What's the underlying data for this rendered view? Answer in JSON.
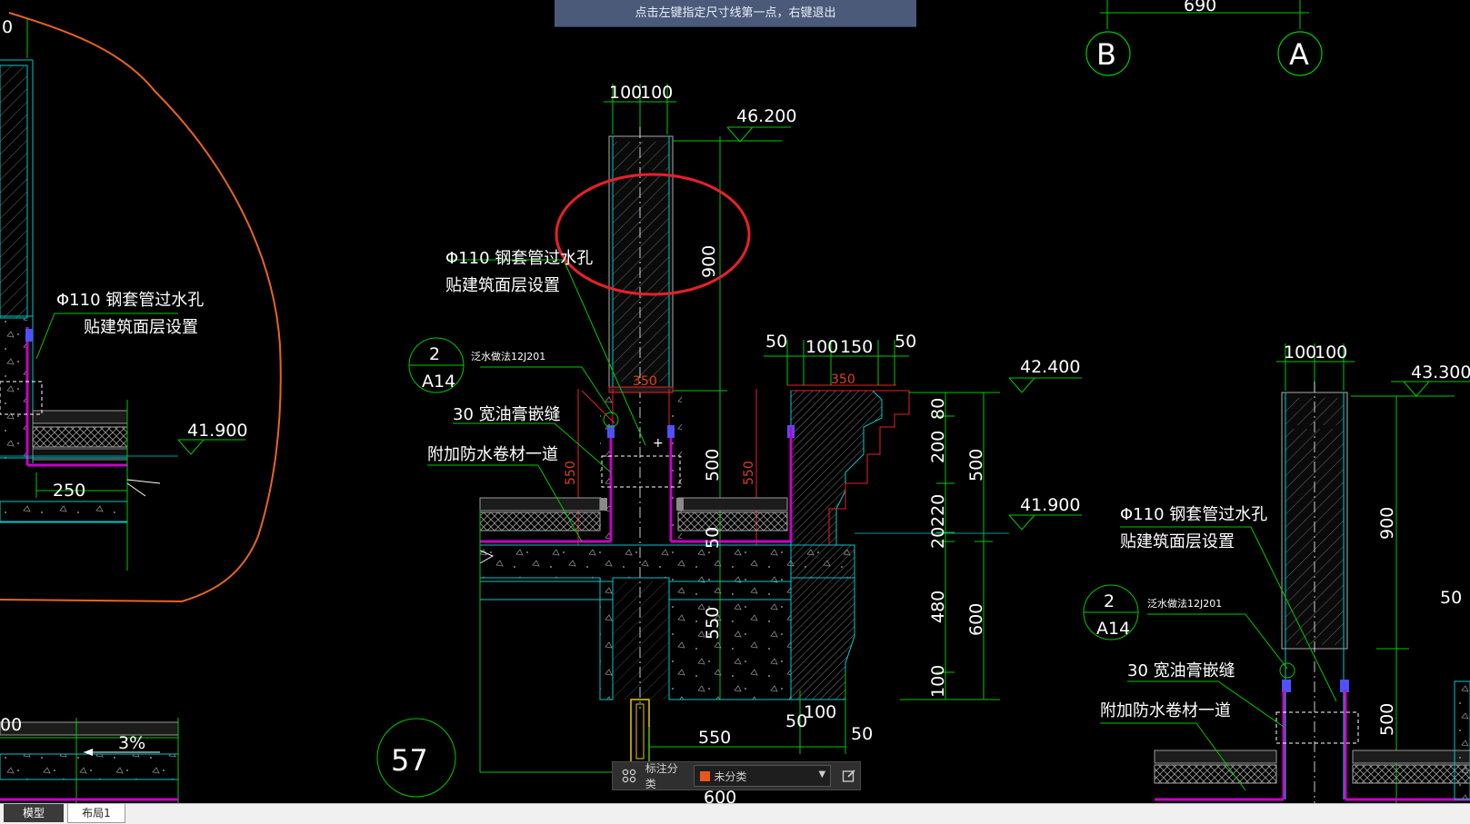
{
  "prompt": "点击左键指定尺寸线第一点，右键退出",
  "axes": [
    "B",
    "A"
  ],
  "detail_number": "57",
  "dimensions": {
    "top_690": "690",
    "wall_100a": "100",
    "wall_100b": "100",
    "elev_46200": "46.200",
    "dim_900": "900",
    "dim_50a": "50",
    "dim_100": "100",
    "dim_150": "150",
    "dim_50b": "50",
    "elev_42400": "42.400",
    "elev_41900_mid": "41.900",
    "elev_41900_left": "41.900",
    "dim_250": "250",
    "dim_80": "80",
    "dim_200": "200",
    "dim_500_right": "500",
    "dim_220": "220",
    "dim_20": "20",
    "dim_480": "480",
    "dim_600_right": "600",
    "dim_100_bottom": "100",
    "dim_500_mid": "500",
    "dim_550_mid": "550",
    "dim_550_red_left": "550",
    "dim_550_red_right": "550",
    "dim_50_mid": "50",
    "dim_550_bottom": "550",
    "dim_50_bottom": "50",
    "dim_100_bottom2": "100",
    "dim_50_bottom3": "50",
    "dim_600_bottom": "600",
    "dim_00": "00",
    "slope": "3%",
    "left_top": "0",
    "r_wall_100a": "100",
    "r_wall_100b": "100",
    "r_elev_43300": "43.300",
    "r_dim_900": "900",
    "r_dim_500": "500",
    "r_dim_50": "50",
    "red_350a": "350",
    "red_350b": "350"
  },
  "notes": {
    "pipe_mid": "Φ110 钢套管过水孔",
    "face_mid": "贴建筑面层设置",
    "pipe_left": "Φ110 钢套管过水孔",
    "face_left": "贴建筑面层设置",
    "pipe_right": "Φ110 钢套管过水孔",
    "face_right": "贴建筑面层设置",
    "ref_mid": "泛水做法12J201",
    "ref_right": "泛水做法12J201",
    "joint_mid": "30 宽油膏嵌缝",
    "joint_right": "30 宽油膏嵌缝",
    "membrane_mid": "附加防水卷材一道",
    "membrane_right": "附加防水卷材一道"
  },
  "callouts": {
    "mid_top": "2",
    "mid_bottom": "A14",
    "right_top": "2",
    "right_bottom": "A14"
  },
  "toolbar": {
    "label": "标注分类",
    "selected": "未分类",
    "swatch_color": "#e8581c"
  },
  "tabs": {
    "model": "模型",
    "layout1": "布局1"
  },
  "colors": {
    "background": "#000000",
    "dimension_green": "#00c800",
    "outline_cyan": "#00c8c8",
    "markup_red": "#e8202a",
    "sketch_orange": "#e8641e",
    "membrane_magenta": "#c800c8"
  }
}
